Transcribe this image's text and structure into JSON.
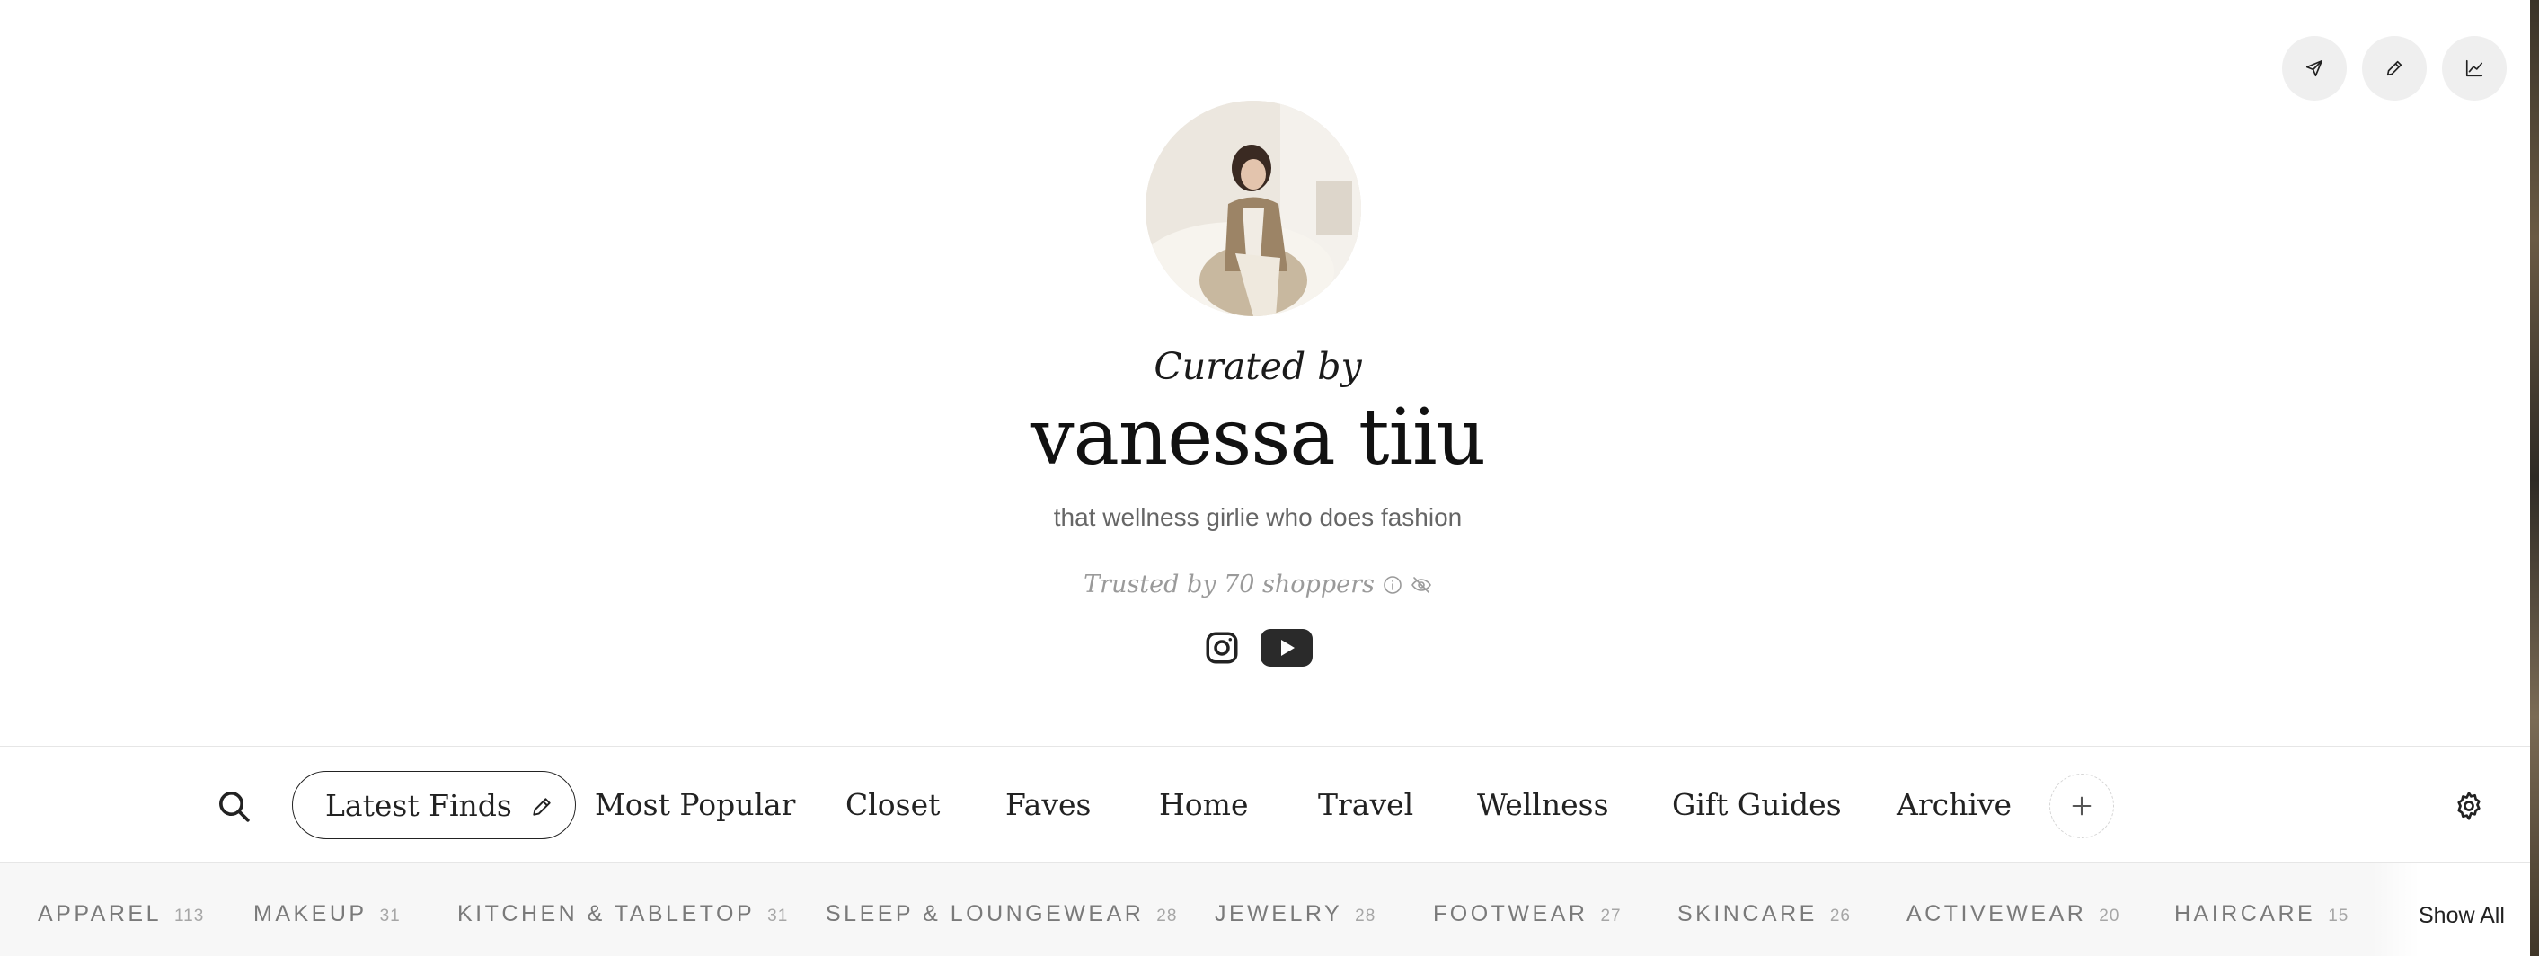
{
  "header": {
    "actions": [
      {
        "icon": "send-icon"
      },
      {
        "icon": "pencil-icon"
      },
      {
        "icon": "analytics-icon"
      }
    ]
  },
  "profile": {
    "curated_label": "Curated by",
    "name": "vanessa tiiu",
    "bio": "that wellness girlie who does fashion",
    "trusted_text": "Trusted by 70 shoppers",
    "socials": [
      {
        "icon": "instagram-icon"
      },
      {
        "icon": "youtube-icon"
      }
    ]
  },
  "nav": {
    "tabs": [
      {
        "label": "Latest Finds",
        "active": true
      },
      {
        "label": "Most Popular"
      },
      {
        "label": "Closet"
      },
      {
        "label": "Faves"
      },
      {
        "label": "Home"
      },
      {
        "label": "Travel"
      },
      {
        "label": "Wellness"
      },
      {
        "label": "Gift Guides"
      },
      {
        "label": "Archive"
      }
    ]
  },
  "categories": {
    "items": [
      {
        "label": "APPAREL",
        "count": "113"
      },
      {
        "label": "MAKEUP",
        "count": "31"
      },
      {
        "label": "KITCHEN & TABLETOP",
        "count": "31"
      },
      {
        "label": "SLEEP & LOUNGEWEAR",
        "count": "28"
      },
      {
        "label": "JEWELRY",
        "count": "28"
      },
      {
        "label": "FOOTWEAR",
        "count": "27"
      },
      {
        "label": "SKINCARE",
        "count": "26"
      },
      {
        "label": "ACTIVEWEAR",
        "count": "20"
      },
      {
        "label": "HAIRCARE",
        "count": "15"
      }
    ],
    "show_all_label": "Show All"
  }
}
